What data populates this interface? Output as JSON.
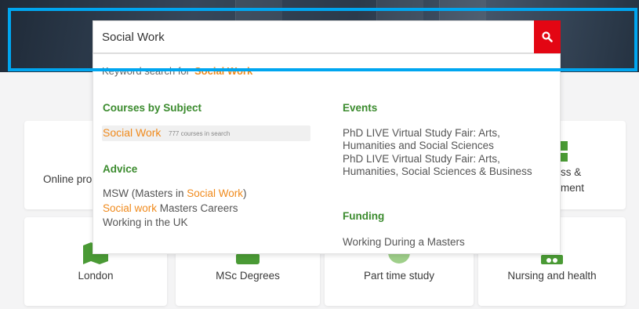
{
  "search": {
    "query": "Social Work",
    "button_icon": "search-icon",
    "button_color": "#e30613"
  },
  "highlight_color": "#00a6f0",
  "dropdown": {
    "keyword_prefix": "Keyword search for",
    "keyword_term": "Social Work",
    "courses_by_subject": {
      "title": "Courses by Subject",
      "item_name": "Social Work",
      "item_count": "777 courses in search"
    },
    "advice": {
      "title": "Advice",
      "items": [
        {
          "prefix": "MSW (Masters in ",
          "highlight": "Social Work",
          "suffix": ")"
        },
        {
          "prefix": "",
          "highlight": "Social work",
          "suffix": " Masters Careers"
        },
        {
          "prefix": "Working in the UK",
          "highlight": "",
          "suffix": ""
        }
      ]
    },
    "events": {
      "title": "Events",
      "items": [
        "PhD LIVE Virtual Study Fair: Arts, Humanities and Social Sciences",
        "PhD LIVE Virtual Study Fair: Arts, Humanities, Social Sciences & Business"
      ]
    },
    "funding": {
      "title": "Funding",
      "items": [
        "Working During a Masters"
      ]
    },
    "section_title_color": "#3b8b2e",
    "highlight_text_color": "#f08a1c"
  },
  "cards_row1": {
    "left_label_visible": "Online pro",
    "right_label_line1_visible": "ss &",
    "right_label_line2_visible": "ment"
  },
  "cards_row2": [
    {
      "label": "London",
      "icon": "map-icon"
    },
    {
      "label": "MSc Degrees",
      "icon": "flask-icon"
    },
    {
      "label": "Part time study",
      "icon": "clock-icon"
    },
    {
      "label": "Nursing and health",
      "icon": "stethoscope-icon"
    }
  ]
}
